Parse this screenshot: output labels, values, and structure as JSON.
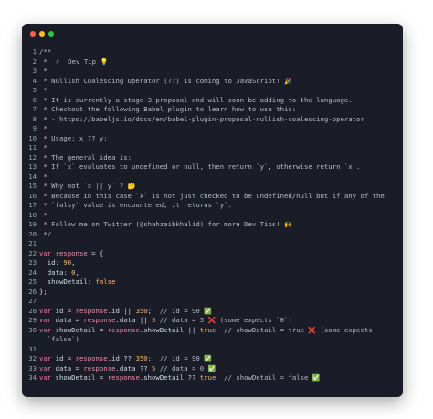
{
  "window": {
    "controls": [
      "close",
      "minimize",
      "maximize"
    ]
  },
  "lines": [
    {
      "n": "1",
      "text": "/**"
    },
    {
      "n": "2",
      "text": " *  ⚡  Dev Tip 💡"
    },
    {
      "n": "3",
      "text": " *"
    },
    {
      "n": "4",
      "text": " * Nullish Coalescing Operator (??) is coming to JavaScript! 🎉"
    },
    {
      "n": "5",
      "text": " *"
    },
    {
      "n": "6",
      "text": " * It is currently a stage-3 proposal and will soon be adding to the language."
    },
    {
      "n": "7",
      "text": " * Checkout the following Babel plugin to learn how to use this:"
    },
    {
      "n": "8",
      "text": " * - https://babeljs.io/docs/en/babel-plugin-proposal-nullish-coalescing-operator"
    },
    {
      "n": "9",
      "text": " *"
    },
    {
      "n": "10",
      "text": " * Usage: x ?? y;"
    },
    {
      "n": "11",
      "text": " *"
    },
    {
      "n": "12",
      "text": " * The general idea is:"
    },
    {
      "n": "13",
      "text": " * If `x` evaluates to undefined or null, then return `y`, otherwise return `x`."
    },
    {
      "n": "14",
      "text": " *"
    },
    {
      "n": "15",
      "text": " * Why not `x || y` ? 🤔"
    },
    {
      "n": "16",
      "text": " * Because in this case `x` is not just checked to be undefined/null but if any of the"
    },
    {
      "n": "17",
      "text": " * `falsy` value is encountered, it returns `y`."
    },
    {
      "n": "18",
      "text": " *"
    },
    {
      "n": "19",
      "text": " * Follow me on Twitter (@shahzaibkhalid) for more Dev Tips! 🙌"
    },
    {
      "n": "20",
      "text": " */"
    },
    {
      "n": "21",
      "text": ""
    },
    {
      "n": "22",
      "text": "var response = {"
    },
    {
      "n": "23",
      "text": "  id: 90,"
    },
    {
      "n": "24",
      "text": "  data: 0,"
    },
    {
      "n": "25",
      "text": "  showDetail: false"
    },
    {
      "n": "26",
      "text": "};"
    },
    {
      "n": "27",
      "text": ""
    },
    {
      "n": "28",
      "text": "var id = response.id || 350;  // id = 90 ✅"
    },
    {
      "n": "29",
      "text": "var data = response.data || 5 // data = 5 ❌ (some expects `0`)"
    },
    {
      "n": "30",
      "text": "var showDetail = response.showDetail || true  // showDetail = true ❌ (some expects"
    },
    {
      "n": "",
      "text": "  `false`)"
    },
    {
      "n": "31",
      "text": ""
    },
    {
      "n": "32",
      "text": "var id = response.id ?? 350;  // id = 90 ✅"
    },
    {
      "n": "33",
      "text": "var data = response.data ?? 5 // data = 0 ✅"
    },
    {
      "n": "34",
      "text": "var showDetail = response.showDetail ?? true  // showDetail = false ✅"
    }
  ]
}
